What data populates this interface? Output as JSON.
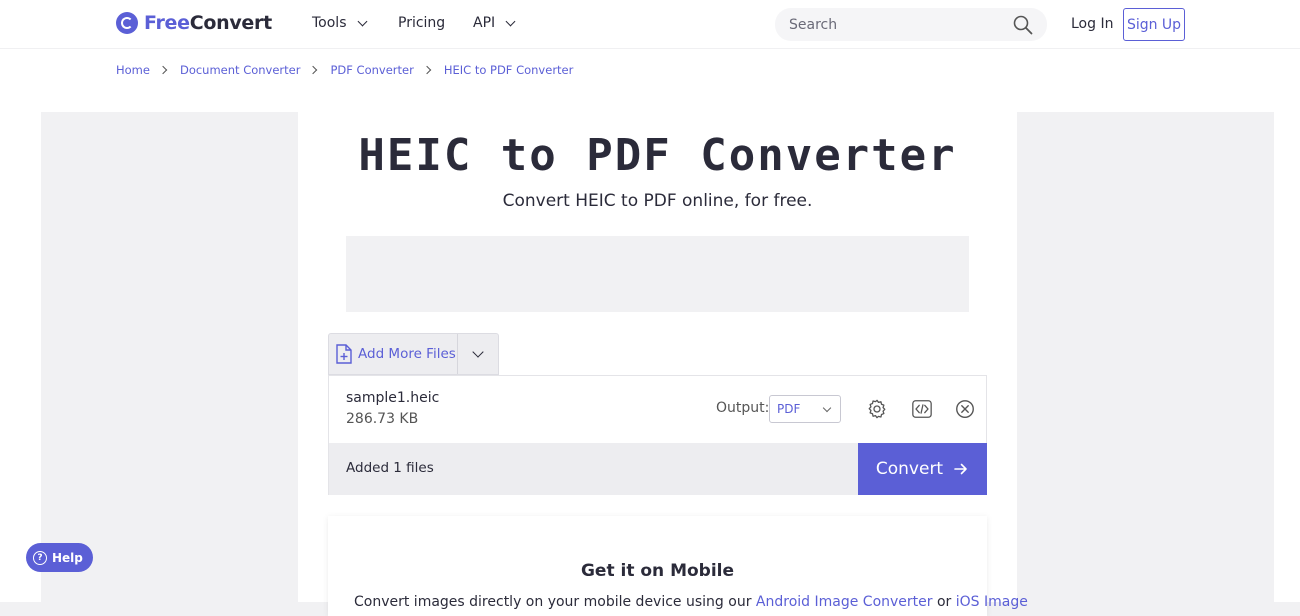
{
  "header": {
    "logo": {
      "free": "Free",
      "convert": "Convert"
    },
    "nav": [
      {
        "label": "Tools",
        "has_dropdown": true
      },
      {
        "label": "Pricing",
        "has_dropdown": false
      },
      {
        "label": "API",
        "has_dropdown": true
      }
    ],
    "search": {
      "placeholder": "Search",
      "icon": "search-icon"
    },
    "login_label": "Log In",
    "signup_label": "Sign Up"
  },
  "breadcrumb": [
    "Home",
    "Document Converter",
    "PDF Converter",
    "HEIC to PDF Converter"
  ],
  "main": {
    "title": "HEIC to PDF Converter",
    "subtitle": "Convert HEIC to PDF online, for free."
  },
  "uploader": {
    "add_files_label": "Add More Files",
    "file": {
      "name": "sample1.heic",
      "size": "286.73 KB"
    },
    "output_label": "Output:",
    "output_value": "PDF",
    "icons": [
      "gear-icon",
      "code-icon",
      "close-circle-icon"
    ],
    "added_text": "Added 1 files",
    "convert_label": "Convert"
  },
  "mobile": {
    "title": "Get it on Mobile",
    "text_prefix": "Convert images directly on your mobile device using our",
    "link1": "Android Image Converter",
    "text_mid": "or",
    "link2": "iOS Image"
  },
  "help_label": "Help",
  "colors": {
    "accent": "#5b5fd6",
    "text": "#2b2b3a",
    "panel": "#ededf0"
  }
}
